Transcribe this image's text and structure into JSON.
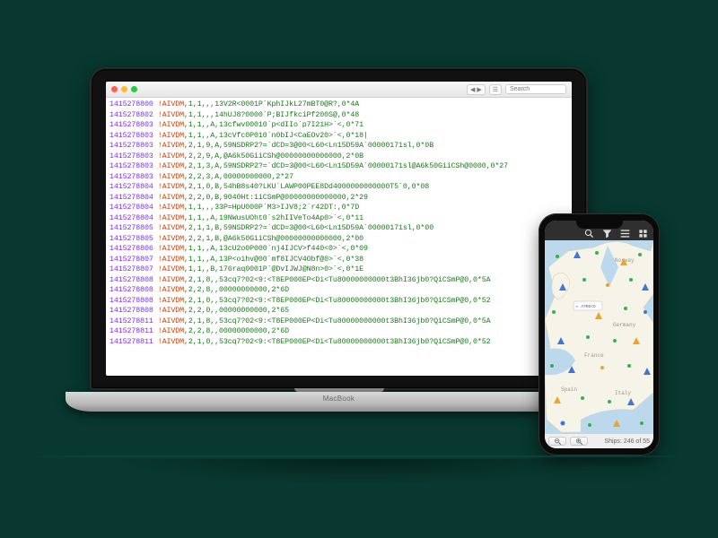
{
  "laptop": {
    "brand": "MacBook",
    "toolbar": {
      "nav_label": "◀ ▶",
      "layers_label": "☰",
      "search_placeholder": "Search"
    },
    "editor_lines": [
      {
        "ts": "1415278800",
        "tag": "!AIVDM",
        "body": ",1,1,,,13V2R<0001P`KphIJkL27mBT0@R?,0*4A"
      },
      {
        "ts": "1415278802",
        "tag": "!AIVDM",
        "body": ",1,1,,,14hUJ8?0000`P;BIJfkciPf200S@,0*48"
      },
      {
        "ts": "1415278803",
        "tag": "!AIVDM",
        "body": ",1,1,,A,13cfwv00010`p<dIIo`p7I21H>`<,0*71"
      },
      {
        "ts": "1415278803",
        "tag": "!AIVDM",
        "body": ",1,1,,A,13cVfc0P010`n0bIJ<CaEOv20>`<,0*18|"
      },
      {
        "ts": "1415278803",
        "tag": "!AIVDM",
        "body": ",2,1,9,A,59NSDRP2?=`dCD=3@00<L60<Ln15D59A`00000171sl,0*0B"
      },
      {
        "ts": "1415278803",
        "tag": "!AIVDM",
        "body": ",2,2,9,A,@A6k50GiiCSh@00000000000000,2*0B"
      },
      {
        "ts": "1415278803",
        "tag": "!AIVDM",
        "body": ",2,1,3,A,59NSDRP2?=`dCD=3@00<L60<Ln15D59A`00000171sl@A6k50GiiCSh@0000,0*27"
      },
      {
        "ts": "1415278803",
        "tag": "!AIVDM",
        "body": ",2,2,3,A,00000000000,2*27"
      },
      {
        "ts": "1415278804",
        "tag": "!AIVDM",
        "body": ",2,1,0,B,54hB8s40?LKU`LAWP00PEE8Dd4000000000000T5`0,0*08"
      },
      {
        "ts": "1415278804",
        "tag": "!AIVDM",
        "body": ",2,2,0,B,9040Ht:1iCSmP@00000000000000,2*29"
      },
      {
        "ts": "1415278804",
        "tag": "!AIVDM",
        "body": ",1,1,,,33P=HpU000P`M3>IJV8;2`r42DT:,0*7D"
      },
      {
        "ts": "1415278804",
        "tag": "!AIVDM",
        "body": ",1,1,,A,19NWusUOht0`s2hIIVeTo4Ap0>`<,0*11"
      },
      {
        "ts": "1415278805",
        "tag": "!AIVDM",
        "body": ",2,1,1,B,59NSDRP2?=`dCD=3@00<L60<Ln15D59A`00000171sl,0*00"
      },
      {
        "ts": "1415278805",
        "tag": "!AIVDM",
        "body": ",2,2,1,B,@A6k50GiiCSh@00000000000000,2*00"
      },
      {
        "ts": "1415278806",
        "tag": "!AIVDM",
        "body": ",1,1,,A,13cU2o0P000`nj4IJCV>f440<0>`<,0*09"
      },
      {
        "ts": "1415278807",
        "tag": "!AIVDM",
        "body": ",1,1,,A,13P<oihv@00`mf8IJCV4Obf@0>`<,0*38"
      },
      {
        "ts": "1415278807",
        "tag": "!AIVDM",
        "body": ",1,1,,B,176raq0001P`@DvIJWJ@N8n>0>`<,0*1E"
      },
      {
        "ts": "1415278808",
        "tag": "!AIVDM",
        "body": ",2,1,8,,53cq7?02<9:<T8EP000EP<Di<Tu80000000000t3BhI36jb0?QiCSmP@0,0*5A"
      },
      {
        "ts": "1415278808",
        "tag": "!AIVDM",
        "body": ",2,2,8,,00000000000,2*6D"
      },
      {
        "ts": "1415278808",
        "tag": "!AIVDM",
        "body": ",2,1,0,,53cq7?02<9:<T8EP000EP<Di<Tu80000000000t3BhI36jb0?QiCSmP@0,0*52"
      },
      {
        "ts": "1415278808",
        "tag": "!AIVDM",
        "body": ",2,2,0,,00000000000,2*65"
      },
      {
        "ts": "1415278811",
        "tag": "!AIVDM",
        "body": ",2,1,8,,53cq7?02<9:<T8EP000EP<Di<Tu80000000000t3BhI36jb0?QiCSmP@0,0*5A"
      },
      {
        "ts": "1415278811",
        "tag": "!AIVDM",
        "body": ",2,2,8,,00000000000,2*6D"
      },
      {
        "ts": "1415278811",
        "tag": "!AIVDM",
        "body": ",2,1,0,,53cq7?02<9:<T8EP000EP<Di<Tu80000000000t3BhI36jb0?QiCSmP@0,0*52"
      }
    ]
  },
  "phone": {
    "toolbar_icons": {
      "search": "search-icon",
      "filter": "filter-icon",
      "list": "list-icon",
      "settings": "settings-icon"
    },
    "map": {
      "countries_visible": [
        "Norway",
        "Spain",
        "France",
        "Germany",
        "Italy"
      ],
      "ships_status_text": "Ships: 246 of 55"
    },
    "zoom_out_label": "−",
    "zoom_in_label": "+"
  },
  "colors": {
    "background": "#08382f",
    "ts": "#7a2fff",
    "tag": "#d63b00",
    "body": "#1a7a1a"
  }
}
